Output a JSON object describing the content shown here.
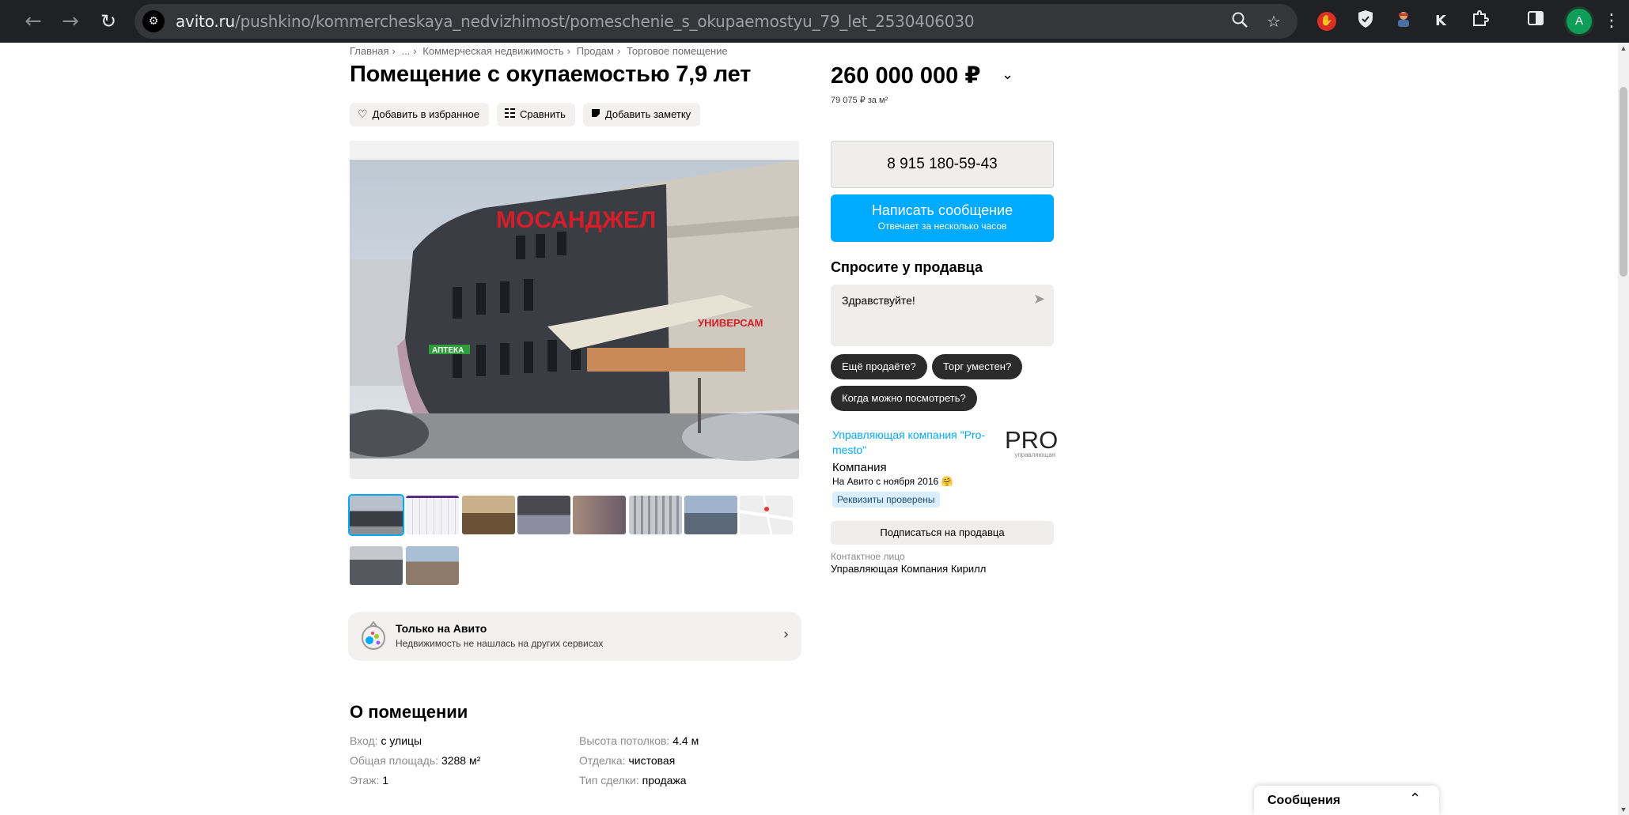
{
  "browser": {
    "url_host": "avito.ru",
    "url_path": "/pushkino/kommercheskaya_nedvizhimost/pomeschenie_s_okupaemostyu_79_let_2530406030",
    "profile_initial": "A"
  },
  "breadcrumb": [
    "Главная",
    "...",
    "Коммерческая недвижимость",
    "Продам",
    "Торговое помещение"
  ],
  "listing": {
    "title": "Помещение с окупаемостью 7,9 лет",
    "price": "260 000 000 ₽",
    "price_per_m2": "79 075 ₽ за м²"
  },
  "actions": {
    "favorite": "Добавить в избранное",
    "compare": "Сравнить",
    "note": "Добавить заметку"
  },
  "contact": {
    "phone": "8 915 180-59-43",
    "message_label": "Написать сообщение",
    "message_sub": "Отвечает за несколько часов"
  },
  "ask": {
    "title": "Спросите у продавца",
    "placeholder_text": "Здравствуйте!",
    "chips": [
      "Ещё продаёте?",
      "Торг уместен?",
      "Когда можно посмотреть?"
    ]
  },
  "seller": {
    "name": "Управляющая компания \"Pro-mesto\"",
    "logo_text": "PRO",
    "logo_sub": "управляющая",
    "type": "Компания",
    "since": "На Авито с ноября 2016 🤗",
    "verified": "Реквизиты проверены",
    "subscribe": "Подписаться на продавца",
    "contact_label": "Контактное лицо",
    "contact_name": "Управляющая Компания Кирилл"
  },
  "only_avito": {
    "title": "Только на Авито",
    "subtitle": "Недвижимость не нашлась на других сервисах"
  },
  "about": {
    "title": "О помещении",
    "params": [
      {
        "label": "Вход:",
        "value": "с улицы"
      },
      {
        "label": "Общая площадь:",
        "value": "3288 м²"
      },
      {
        "label": "Этаж:",
        "value": "1"
      },
      {
        "label": "Высота потолков:",
        "value": "4.4 м"
      },
      {
        "label": "Отделка:",
        "value": "чистовая"
      },
      {
        "label": "Тип сделки:",
        "value": "продажа"
      }
    ]
  },
  "messages_widget": {
    "label": "Сообщения"
  },
  "photos": {
    "main_signs": [
      "МОСАНДЖЕЛ",
      "УНИВЕРСАМ",
      "АПТЕКА"
    ],
    "thumbnail_count": 10
  }
}
